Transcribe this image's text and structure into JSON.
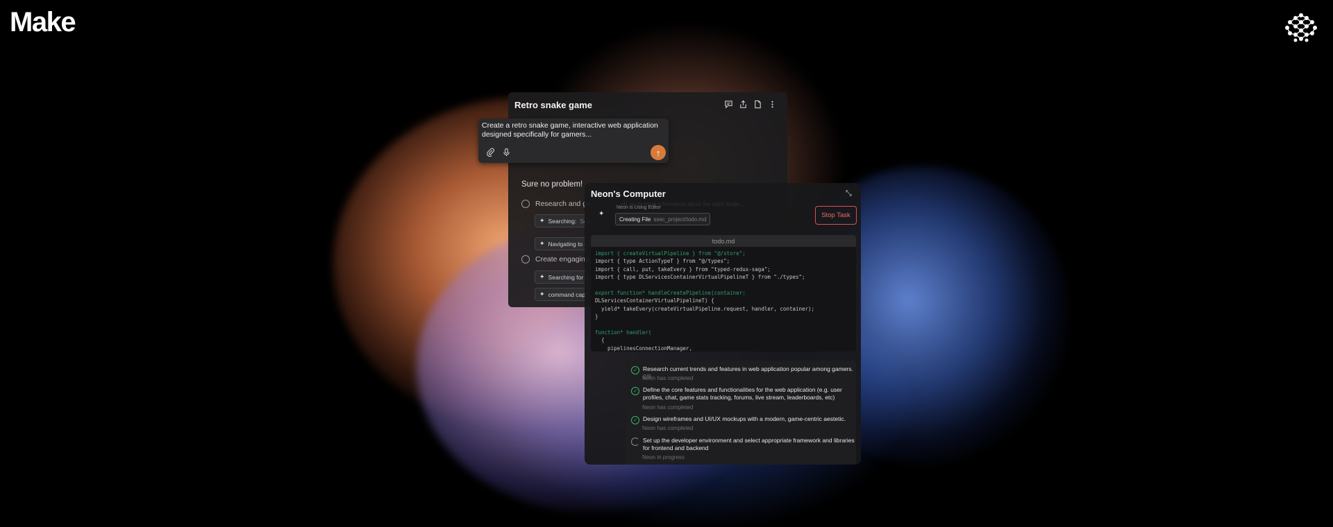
{
  "brand": {
    "name": "Make"
  },
  "icons": {
    "logo": "network-logo-icon"
  },
  "project": {
    "title": "Retro snake game",
    "prompt": "Create a retro snake game, interactive web application designed specifically for gamers...",
    "reply": "Sure no problem!",
    "send_glyph": "↑"
  },
  "chat_steps": [
    {
      "label": "Research and ga"
    },
    {
      "label": "Create engaging"
    }
  ],
  "chat_chips": [
    {
      "label": "Searching:",
      "detail": "Sea"
    },
    {
      "label": "Navigating to u",
      "detail": ""
    },
    {
      "label": "Searching for n",
      "detail": ""
    },
    {
      "label": "command capt",
      "detail": ""
    }
  ],
  "computer": {
    "title": "Neon's Computer",
    "status_faint": "Neon is Using Editor",
    "overlay_faint": "...ch, go to more information about the color mode...",
    "creating_label": "Creating File",
    "creating_path": "ssec_project/todo.md",
    "stop_label": "Stop Task",
    "file_name": "todo.md"
  },
  "code_lines": [
    {
      "text": "import { createVirtualPipeline } from \"@/store\";",
      "green": true
    },
    {
      "text": "import { type ActionTypeT } from \"@/types\";",
      "green": false
    },
    {
      "text": "import { call, put, takeEvery } from \"typed-redux-saga\";",
      "green": false
    },
    {
      "text": "import { type DLServicesContainerVirtualPipelineT } from \"./types\";",
      "green": false
    },
    {
      "text": "",
      "green": false
    },
    {
      "text": "export function* handleCreatePipeline(container:",
      "green": true
    },
    {
      "text": "DLServicesContainerVirtualPipelineT) {",
      "green": false
    },
    {
      "text": "  yield* takeEvery(createVirtualPipeline.request, handler, container);",
      "green": false
    },
    {
      "text": "}",
      "green": false
    },
    {
      "text": "",
      "green": false
    },
    {
      "text": "function* handler(",
      "green": true
    },
    {
      "text": "  {",
      "green": false
    },
    {
      "text": "    pipelinesConnectionManager,",
      "green": false
    }
  ],
  "tasks": [
    {
      "text": "Research current trends and features in web application popular among gamers.",
      "count": "2/9",
      "status": "Neon has completed",
      "done": true
    },
    {
      "text": "Define the core features and functionalities for the web application (e.g. user profiles, chat, game stats tracking, forums, live stream, leaderboards, etc)",
      "count": "",
      "status": "Neon has completed",
      "done": true
    },
    {
      "text": "Design wireframes and UI/UX mockups with a modern, game-centric aestetic.",
      "count": "",
      "status": "Neon has completed",
      "done": true
    },
    {
      "text": "Set up the developer environment and select appropriate framework and libraries for frontend and backend",
      "count": "",
      "status": "Neon in progress",
      "done": false
    }
  ]
}
